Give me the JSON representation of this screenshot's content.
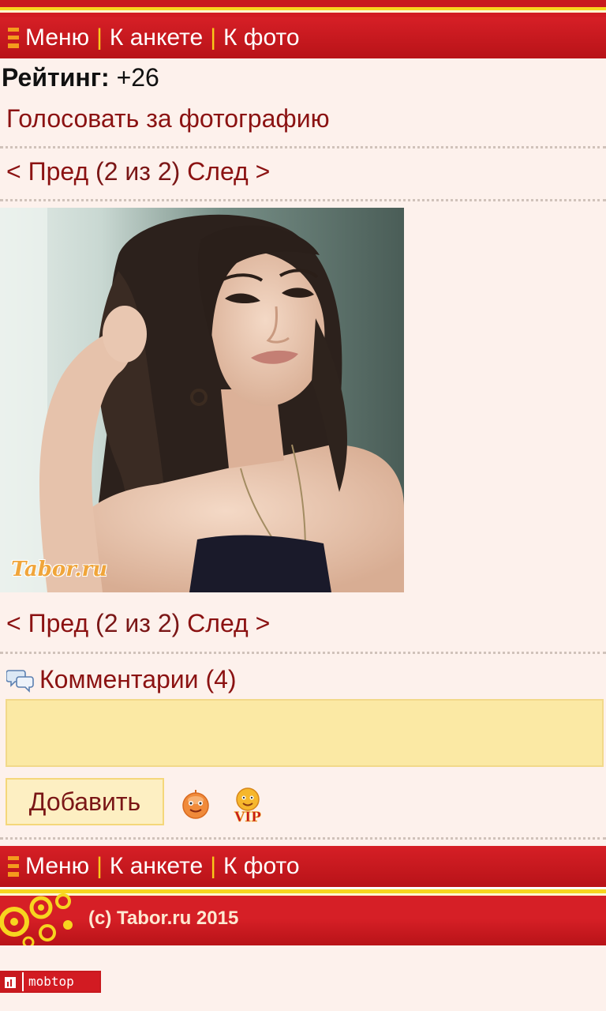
{
  "nav": {
    "menu": "Меню",
    "to_profile": "К анкете",
    "to_photo": "К фото",
    "separator": "|"
  },
  "rating": {
    "label": "Рейтинг:",
    "value": "+26"
  },
  "vote_link": "Голосовать за фотографию",
  "pager": {
    "prev": "< Пред",
    "position": "(2 из 2)",
    "next": "След >"
  },
  "photo": {
    "watermark": "Tabor.ru"
  },
  "comments": {
    "title": "Комментарии (4)",
    "input_value": "",
    "add_button": "Добавить",
    "vip_badge": "VIP"
  },
  "footer": {
    "copyright": "(c) Tabor.ru 2015",
    "counter_label": "mobtop"
  },
  "colors": {
    "bar_red": "#c8191e",
    "accent_yellow": "#f7d51f",
    "link": "#8b1212",
    "background": "#fdf1ec"
  }
}
